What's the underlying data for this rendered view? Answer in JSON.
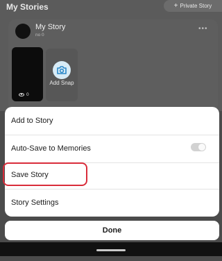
{
  "stories": {
    "section_title": "My Stories",
    "private_story_label": "Private Story",
    "story_name": "My Story",
    "story_subtitle": "no 0",
    "thumb_views": "0",
    "add_snap_label": "Add Snap"
  },
  "sheet": {
    "items": [
      {
        "label": "Add to Story"
      },
      {
        "label": "Auto-Save to Memories",
        "toggle_on": false
      },
      {
        "label": "Save Story"
      },
      {
        "label": "Story Settings"
      }
    ],
    "done_label": "Done"
  },
  "colors": {
    "highlight": "#d92c3a",
    "camera_bg": "#d7ebf6",
    "camera_icon": "#2a88c8"
  }
}
